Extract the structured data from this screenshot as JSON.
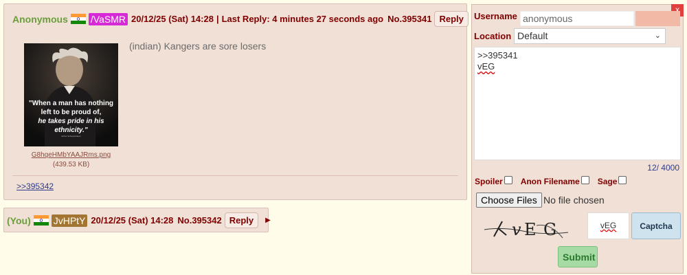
{
  "op_post": {
    "name": "Anonymous",
    "flag": "india-flag-icon",
    "poster_id": "/VaSMR",
    "datetime": "20/12/25 (Sat) 14:28",
    "separator": "|",
    "last_reply": "Last Reply: 4 minutes 27 seconds ago",
    "post_number": "No.395341",
    "reply_label": "Reply",
    "menu_arrow": "▶",
    "file": {
      "name": "G8hqeHMbYAAJRms.png",
      "size": "(439.53 KB)",
      "quote_line1": "\"When a man has nothing",
      "quote_line2": "left to be proud of,",
      "quote_line3": "he takes pride in his",
      "quote_line4": "ethnicity.\"",
      "attribution": "Arthur Schopenhauer"
    },
    "body": "(indian) Kangers are sore losers",
    "backlink": ">>395342"
  },
  "reply_post": {
    "you_label": "(You)",
    "flag": "india-flag-icon",
    "poster_id": "JvHPtY",
    "datetime": "20/12/25 (Sat) 14:28",
    "post_number": "No.395342",
    "reply_label": "Reply",
    "menu_arrow": "▶"
  },
  "reply_form": {
    "close_label": "x",
    "username_label": "Username",
    "username_value": "anonymous",
    "location_label": "Location",
    "location_value": "Default",
    "comment_line1": ">>395341",
    "comment_line2": "vEG",
    "char_count": "12/ 4000",
    "spoiler_label": "Spoiler",
    "anon_filename_label": "Anon Filename",
    "sage_label": "Sage",
    "choose_files_label": "Choose Files",
    "no_file_label": "No file chosen",
    "captcha_text": "vEG",
    "captcha_button_label": "Captcha",
    "submit_label": "Submit"
  },
  "colors": {
    "page_background": "#fffde9",
    "post_background": "#f0e0d6",
    "name_green": "#6b9e3b",
    "text_maroon": "#800000",
    "id_magenta": "#d62ad6",
    "id_brown": "#a37532",
    "submit_green": "#a6dba6",
    "captcha_blue": "#cfe3ef",
    "close_red": "#e0413f"
  }
}
